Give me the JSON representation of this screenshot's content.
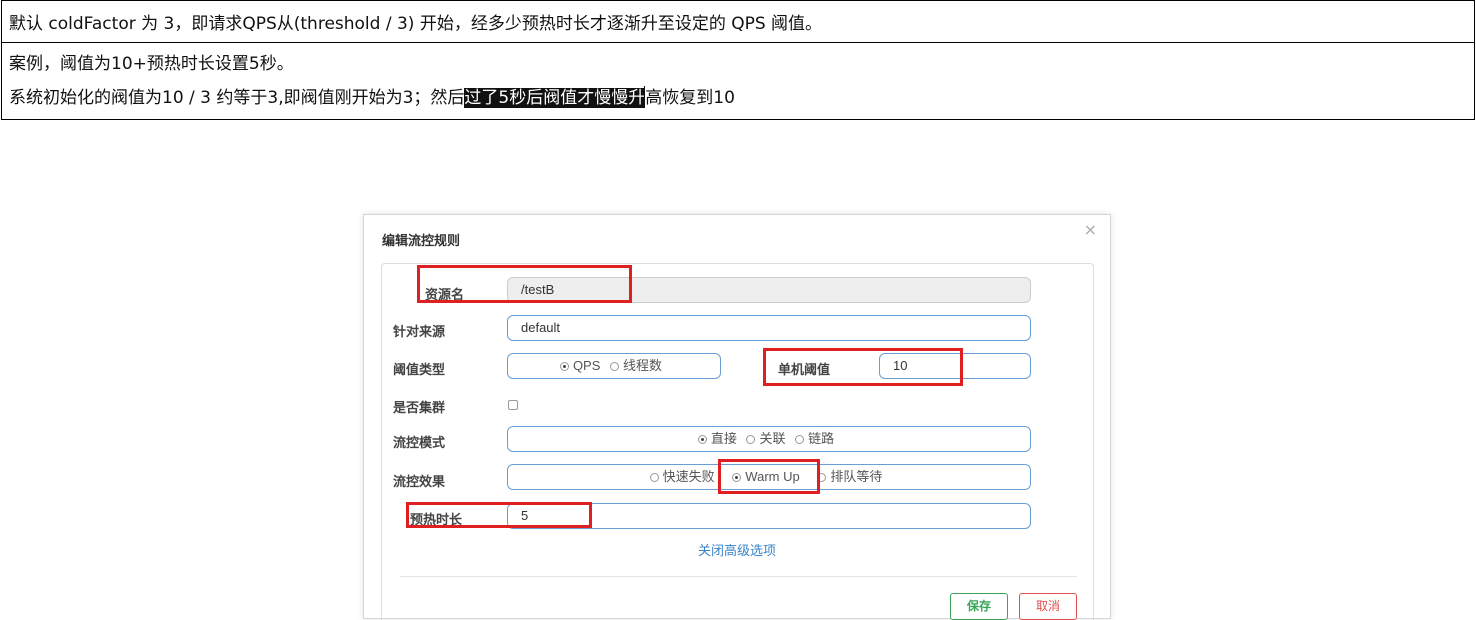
{
  "note": {
    "row1": "默认 coldFactor 为 3，即请求QPS从(threshold / 3) 开始，经多少预热时长才逐渐升至设定的 QPS 阈值。",
    "row2_line1": "案例，阈值为10+预热时长设置5秒。",
    "row2_line2_before": "系统初始化的阀值为10 / 3 约等于3,即阀值刚开始为3；然后",
    "row2_line2_highlight": "过了5秒后阀值才慢慢升",
    "row2_line2_after": "高恢复到10"
  },
  "dialog": {
    "title": "编辑流控规则",
    "close": "×",
    "resource_label": "资源名",
    "resource_value": "/testB",
    "source_label": "针对来源",
    "source_value": "default",
    "threshold_type_label": "阈值类型",
    "threshold_type_options": [
      "QPS",
      "线程数"
    ],
    "threshold_type_selected": "QPS",
    "single_threshold_label": "单机阈值",
    "single_threshold_value": "10",
    "cluster_label": "是否集群",
    "cluster_checked": false,
    "mode_label": "流控模式",
    "mode_options": [
      "直接",
      "关联",
      "链路"
    ],
    "mode_selected": "直接",
    "effect_label": "流控效果",
    "effect_options": [
      "快速失败",
      "Warm Up",
      "排队等待"
    ],
    "effect_selected": "Warm Up",
    "warmup_label": "预热时长",
    "warmup_value": "5",
    "advanced_link": "关闭高级选项",
    "save_button": "保存",
    "cancel_button": "取消"
  },
  "colors": {
    "highlight_bg": "#111111",
    "annotation_red": "#e02020",
    "field_border": "#6a9fd4",
    "save_green": "#3aa55a",
    "cancel_red": "#e05050",
    "link_blue": "#3a83c7"
  }
}
